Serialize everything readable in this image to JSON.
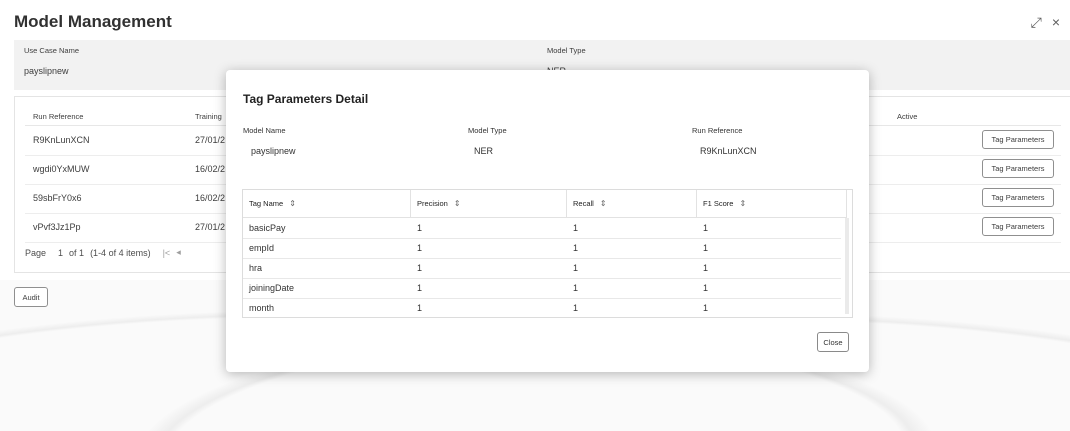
{
  "page": {
    "title": "Model Management",
    "controls": {
      "resize": "⤢",
      "close": "×"
    }
  },
  "usecase": {
    "name_label": "Use Case Name",
    "name_value": "payslipnew",
    "type_label": "Model Type",
    "type_value": "NER"
  },
  "runs": {
    "headers": {
      "run_reference": "Run Reference",
      "training": "Training",
      "active": "Active"
    },
    "rows": [
      {
        "ref": "R9KnLunXCN",
        "date": "27/01/2",
        "button": "Tag Parameters"
      },
      {
        "ref": "wgdi0YxMUW",
        "date": "16/02/2",
        "button": "Tag Parameters"
      },
      {
        "ref": "59sbFrY0x6",
        "date": "16/02/2",
        "button": "Tag Parameters"
      },
      {
        "ref": "vPvf3Jz1Pp",
        "date": "27/01/2",
        "button": "Tag Parameters"
      }
    ],
    "pager": {
      "page_label": "Page",
      "page": "1",
      "of": "of 1",
      "range": "(1-4 of 4 items)",
      "first": "|<",
      "prev": "◂"
    }
  },
  "audit": {
    "label": "Audit"
  },
  "modal": {
    "title": "Tag Parameters Detail",
    "model_name_label": "Model Name",
    "model_name_value": "payslipnew",
    "model_type_label": "Model Type",
    "model_type_value": "NER",
    "run_reference_label": "Run Reference",
    "run_reference_value": "R9KnLunXCN",
    "table": {
      "columns": [
        "Tag Name",
        "Precision",
        "Recall",
        "F1 Score"
      ],
      "rows": [
        [
          "basicPay",
          "1",
          "1",
          "1"
        ],
        [
          "empId",
          "1",
          "1",
          "1"
        ],
        [
          "hra",
          "1",
          "1",
          "1"
        ],
        [
          "joiningDate",
          "1",
          "1",
          "1"
        ],
        [
          "month",
          "1",
          "1",
          "1"
        ]
      ]
    },
    "close_label": "Close"
  }
}
